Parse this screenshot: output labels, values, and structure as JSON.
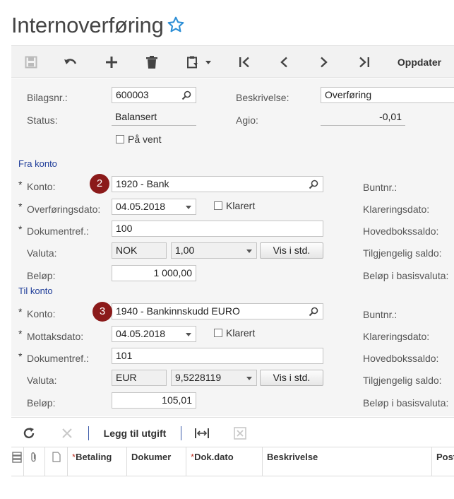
{
  "page": {
    "title": "Internoverføring"
  },
  "toolbar": {
    "refresh_label": "Oppdater"
  },
  "header": {
    "bilagsnr_label": "Bilagsnr.:",
    "bilagsnr_value": "600003",
    "status_label": "Status:",
    "status_value": "Balansert",
    "pa_vent_label": "På vent",
    "beskrivelse_label": "Beskrivelse:",
    "beskrivelse_value": "Overføring",
    "agio_label": "Agio:",
    "agio_value": "-0,01"
  },
  "fra": {
    "section": "Fra konto",
    "badge": "2",
    "konto_label": "Konto:",
    "konto_value": "1920 - Bank",
    "date_label": "Overføringsdato:",
    "date_value": "04.05.2018",
    "klarert_label": "Klarert",
    "dokref_label": "Dokumentref.:",
    "dokref_value": "100",
    "valuta_label": "Valuta:",
    "valuta_value": "NOK",
    "rate_value": "1,00",
    "vis_label": "Vis i std.",
    "belop_label": "Beløp:",
    "belop_value": "1 000,00"
  },
  "til": {
    "section": "Til konto",
    "badge": "3",
    "konto_label": "Konto:",
    "konto_value": "1940 - Bankinnskudd EURO",
    "date_label": "Mottaksdato:",
    "date_value": "04.05.2018",
    "klarert_label": "Klarert",
    "dokref_label": "Dokumentref.:",
    "dokref_value": "101",
    "valuta_label": "Valuta:",
    "valuta_value": "EUR",
    "rate_value": "9,5228119",
    "vis_label": "Vis i std.",
    "belop_label": "Beløp:",
    "belop_value": "105,01"
  },
  "right_labels": {
    "fra": [
      "Buntnr.:",
      "Klareringsdato:",
      "Hovedbokssaldo:",
      "Tilgjengelig saldo:",
      "Beløp i basisvaluta:"
    ],
    "til": [
      "Buntnr.:",
      "Klareringsdato:",
      "Hovedbokssaldo:",
      "Tilgjengelig saldo:",
      "Beløp i basisvaluta:"
    ]
  },
  "grid_toolbar": {
    "add_expense_label": "Legg til utgift"
  },
  "grid": {
    "columns": [
      "Betaling",
      "Dokumer",
      "Dok.dato",
      "Beskrivelse",
      "Post"
    ],
    "required_mark": "*"
  },
  "colors": {
    "accent": "#1f3d99",
    "badge": "#8b1a1a",
    "required": "#c0392b",
    "star": "#2e8fd6"
  },
  "icons": [
    "star-icon",
    "save-icon",
    "undo-icon",
    "add-icon",
    "delete-icon",
    "clipboard-icon",
    "first-icon",
    "prev-icon",
    "next-icon",
    "last-icon",
    "search-icon",
    "refresh-icon",
    "close-icon",
    "fit-icon",
    "export-icon"
  ]
}
